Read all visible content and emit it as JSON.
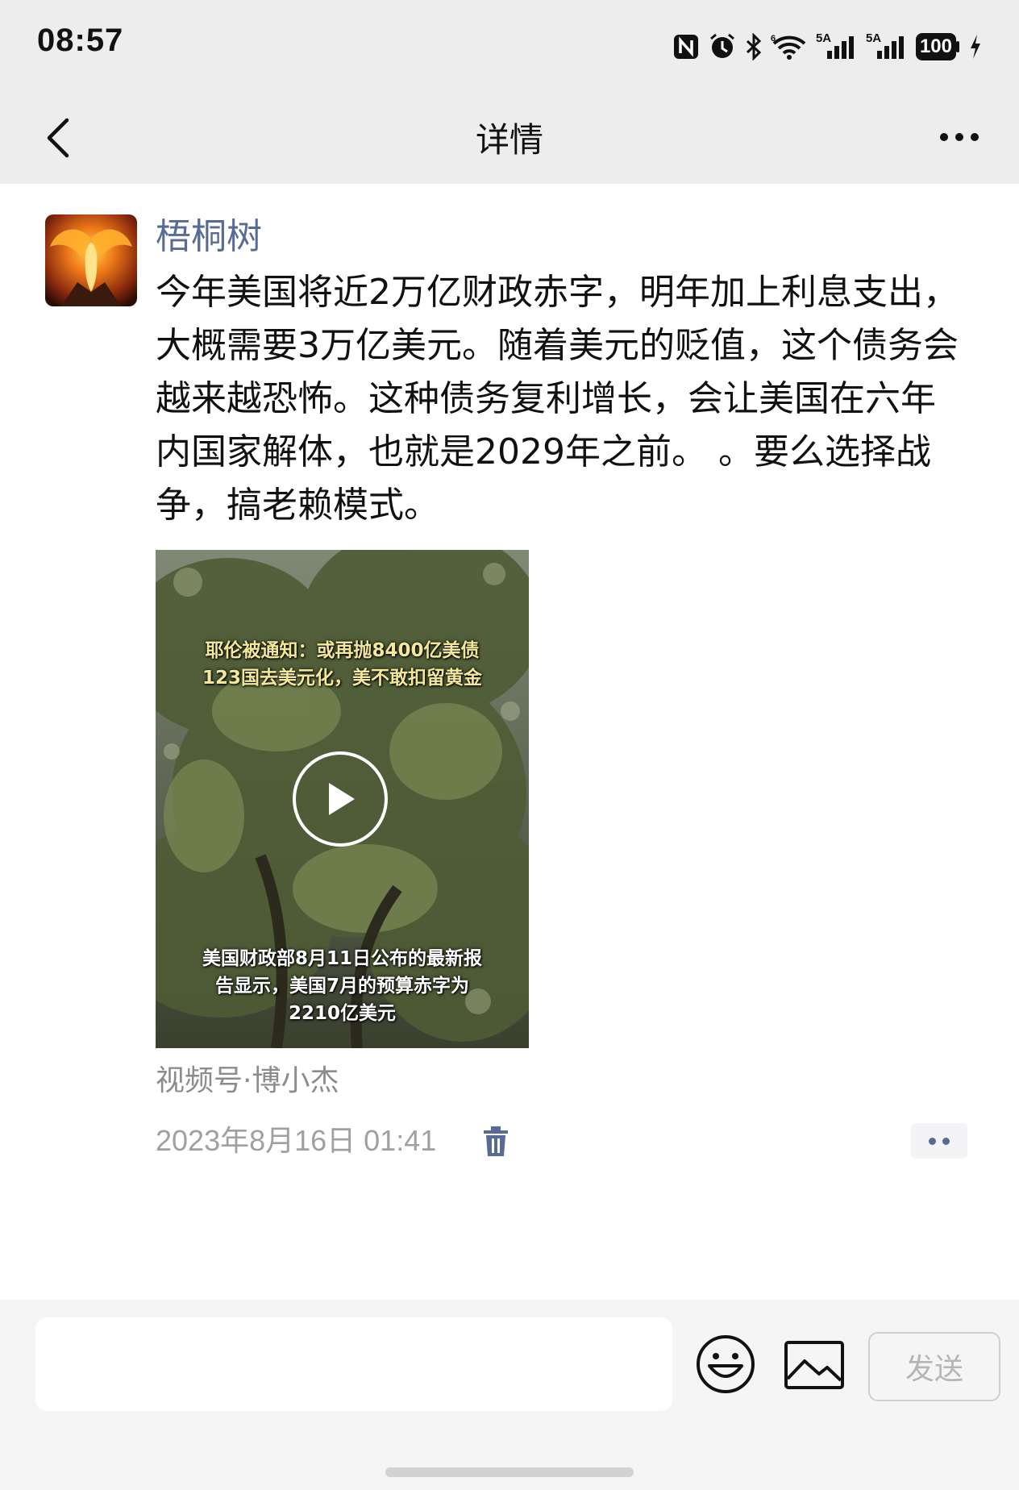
{
  "status_bar": {
    "time": "08:57",
    "icons": [
      "nfc-icon",
      "alarm-icon",
      "bluetooth-icon",
      "wifi-6-icon",
      "signal-5a-icon",
      "signal-5a-icon",
      "battery-icon",
      "charging-icon"
    ],
    "signal1_label": "5A",
    "signal2_label": "5A",
    "battery": "100"
  },
  "nav": {
    "title": "详情",
    "back_icon": "chevron-left-icon",
    "more_icon": "more-dots-icon"
  },
  "post": {
    "author": "梧桐树",
    "avatar_icon": "phoenix-avatar",
    "text": "今年美国将近2万亿财政赤字，明年加上利息支出，大概需要3万亿美元。随着美元的贬值，这个债务会越来越恐怖。这种债务复利增长，会让美国在六年内国家解体，也就是2029年之前。 。要么选择战争，搞老赖模式。",
    "video": {
      "caption_top_1": "耶伦被通知：或再抛8400亿美债",
      "caption_top_2": "123国去美元化，美不敢扣留黄金",
      "caption_bottom_1": "美国财政部8月11日公布的最新报",
      "caption_bottom_2": "告显示，美国7月的预算赤字为",
      "caption_bottom_3": "2210亿美元",
      "play_icon": "play-icon"
    },
    "source": "视频号·博小杰",
    "timestamp": "2023年8月16日 01:41",
    "delete_icon": "trash-icon",
    "action_icon": "more-dots-icon"
  },
  "bottom_bar": {
    "input_value": "",
    "emoji_icon": "emoji-icon",
    "image_icon": "image-icon",
    "send_label": "发送"
  },
  "colors": {
    "author_link": "#576b95",
    "header_bg": "#ededed",
    "meta_text": "#a0a0a0"
  }
}
